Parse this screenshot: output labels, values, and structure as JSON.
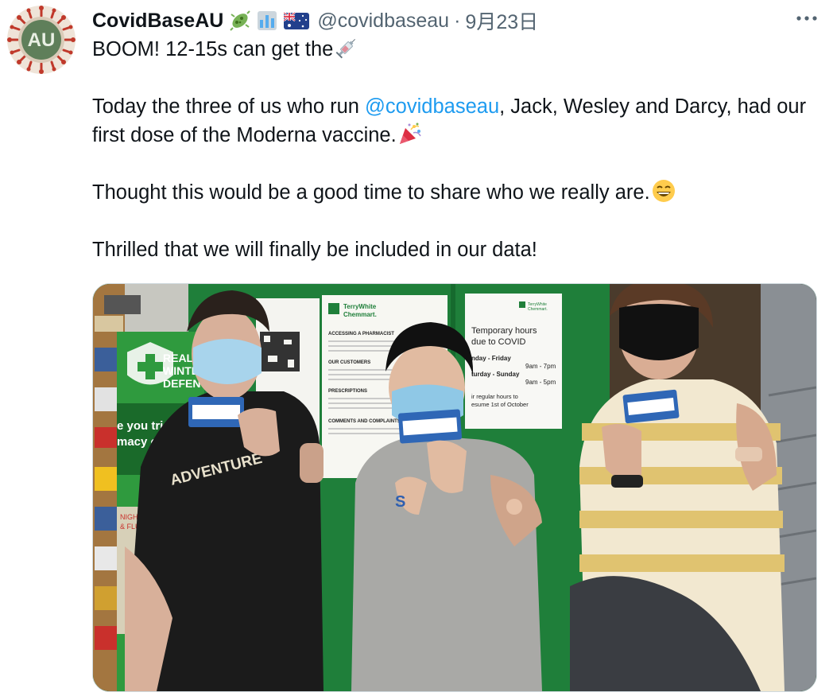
{
  "tweet": {
    "display_name": "CovidBaseAU",
    "name_emojis": [
      "microbe-icon",
      "bar-chart-icon",
      "australian-flag-icon"
    ],
    "handle": "@covidbaseau",
    "separator": "·",
    "timestamp": "9月23日",
    "avatar_text": "AU",
    "more_icon": "ellipsis-icon",
    "body": {
      "line1": "BOOM! 12-15s can get the",
      "line1_emoji": "syringe-icon",
      "p2_before": "Today the three of us who run ",
      "p2_mention": "@covidbaseau",
      "p2_after": ", Jack, Wesley and Darcy, had our first dose of the Moderna vaccine.",
      "p2_emoji": "party-popper-icon",
      "p3": "Thought this would be a good time to share who we really are.",
      "p3_emoji": "grinning-face-icon",
      "p4": "Thrilled that we will finally be included in our data!"
    },
    "photo": {
      "poster_left_lines": [
        "REAL",
        "WINTE",
        "DEFEN"
      ],
      "poster_left_bottom": [
        "e you trie",
        "macy or"
      ],
      "poster_left_flu": [
        "NIGHT",
        "& FLU RELIE"
      ],
      "shirt_text": "ADVENTURE",
      "sign_mid_brand": [
        "TerryWhite",
        "Chemmart."
      ],
      "sign_mid_sections": [
        "ACCESSING A PHARMACIST",
        "OUR CUSTOMERS",
        "PRESCRIPTIONS",
        "COMMENTS AND COMPLAINTS"
      ],
      "sign_right_brand": [
        "TerryWhite",
        "Chemmart."
      ],
      "sign_right_title": [
        "Temporary hours",
        "due to COVID"
      ],
      "sign_right_rows": [
        "nday - Friday",
        "9am - 7pm",
        "turday - Sunday",
        "9am - 5pm"
      ],
      "sign_right_footer": [
        "ir regular hours to",
        "esume 1st of October"
      ]
    }
  }
}
